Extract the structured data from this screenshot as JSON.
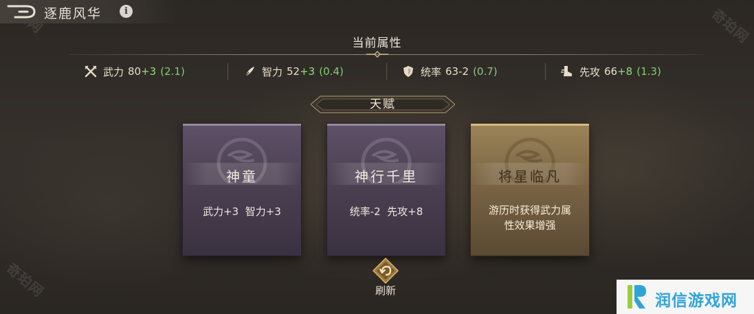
{
  "header": {
    "title": "逐鹿风华",
    "info_icon": "info-icon",
    "back_icon": "back-arrow-icon"
  },
  "attributes": {
    "title": "当前属性",
    "stats": [
      {
        "icon": "crossed-swords-icon",
        "label": "武力",
        "base": "80",
        "bonus": "+3",
        "growth": "(2.1)"
      },
      {
        "icon": "quill-icon",
        "label": "智力",
        "base": "52",
        "bonus": "+3",
        "growth": "(0.4)"
      },
      {
        "icon": "shield-icon",
        "label": "统率",
        "base": "63",
        "bonus": "-2",
        "growth": "(0.7)"
      },
      {
        "icon": "boot-icon",
        "label": "先攻",
        "base": "66",
        "bonus": "+8",
        "growth": "(1.3)"
      }
    ]
  },
  "talents": {
    "title": "天赋",
    "cards": [
      {
        "name": "神童",
        "desc_line1": "武力+3  智力+3",
        "desc_line2": "",
        "theme": "purple"
      },
      {
        "name": "神行千里",
        "desc_line1": "统率-2  先攻+8",
        "desc_line2": "",
        "theme": "purple"
      },
      {
        "name": "将星临凡",
        "desc_line1": "游历时获得武力属",
        "desc_line2": "性效果增强",
        "theme": "gold"
      }
    ]
  },
  "refresh": {
    "label": "刷新",
    "icon": "refresh-icon"
  },
  "watermark": {
    "text": "奇珀网"
  },
  "brand": {
    "text": "润信游戏网",
    "icon": "brand-r-logo"
  },
  "colors": {
    "bonus_positive": "#8fe07a",
    "growth": "#7fd06d",
    "gold_card": "#9a8357",
    "purple_card": "#5e5066"
  }
}
